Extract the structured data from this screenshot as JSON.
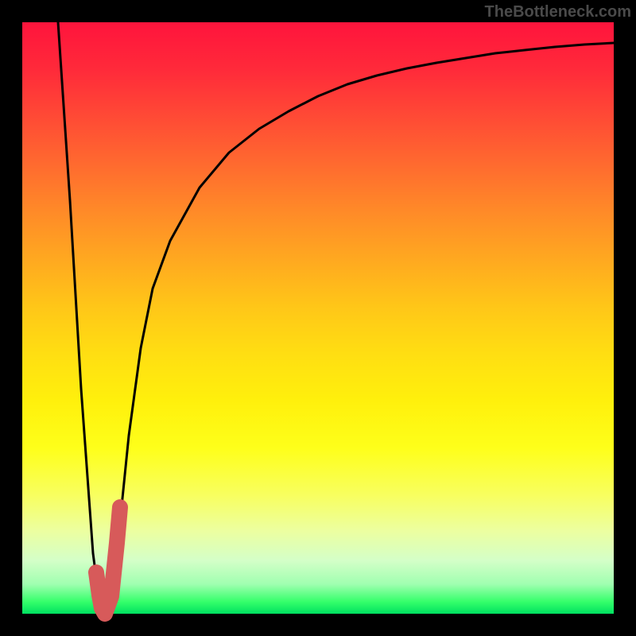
{
  "watermark": "TheBottleneck.com",
  "colors": {
    "curve": "#000000",
    "highlight": "#d75a5a",
    "frame": "#000000"
  },
  "chart_data": {
    "type": "line",
    "title": "",
    "xlabel": "",
    "ylabel": "",
    "xlim": [
      0,
      100
    ],
    "ylim": [
      0,
      100
    ],
    "grid": false,
    "legend": false,
    "background": "gradient red→yellow→green (top→bottom)",
    "series": [
      {
        "name": "bottleneck-curve",
        "x": [
          6,
          8,
          10,
          12,
          13,
          14,
          15,
          16,
          18,
          20,
          22,
          25,
          30,
          35,
          40,
          45,
          50,
          55,
          60,
          65,
          70,
          75,
          80,
          85,
          90,
          95,
          100
        ],
        "values": [
          100,
          70,
          38,
          10,
          2,
          0,
          2,
          10,
          30,
          45,
          55,
          63,
          72,
          78,
          82,
          85,
          87.5,
          89.5,
          91,
          92.2,
          93.2,
          94,
          94.7,
          95.3,
          95.8,
          96.2,
          96.5
        ]
      },
      {
        "name": "optimal-region-highlight",
        "x": [
          12.5,
          13,
          13.5,
          14,
          15,
          16,
          16.5
        ],
        "values": [
          7,
          3,
          1,
          0,
          3,
          12,
          18
        ]
      }
    ]
  }
}
